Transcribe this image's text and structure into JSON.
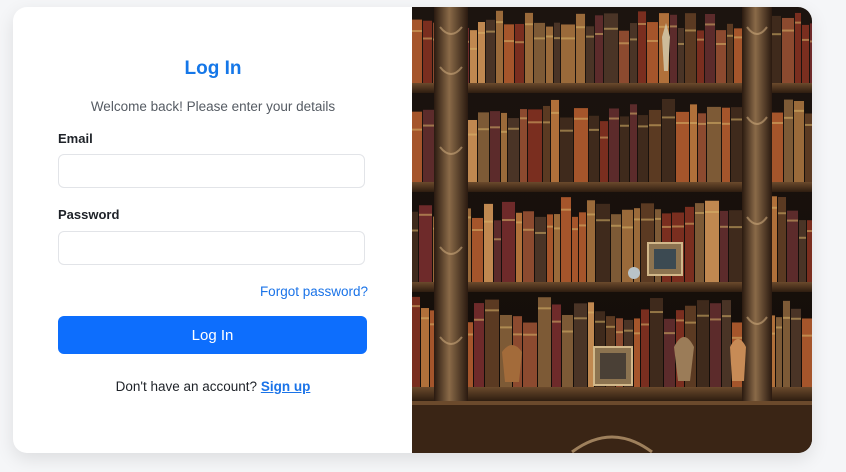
{
  "login": {
    "title": "Log In",
    "subtitle": "Welcome back! Please enter your details",
    "email_label": "Email",
    "email_value": "",
    "password_label": "Password",
    "password_value": "",
    "forgot_link": "Forgot password?",
    "submit_label": "Log In",
    "signup_prompt": "Don't have an account?",
    "signup_link": "Sign up"
  },
  "colors": {
    "accent": "#0d6efd",
    "title": "#1577e8",
    "link": "#1a73e8"
  },
  "hero_image": {
    "subject": "antique bookshelf filled with leather-bound books"
  }
}
